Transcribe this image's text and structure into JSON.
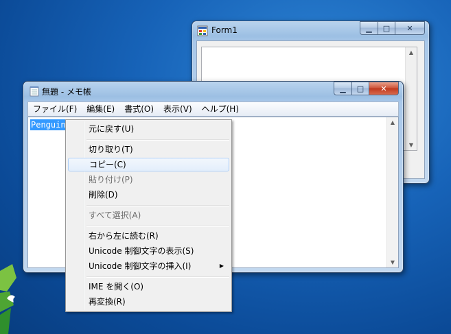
{
  "form1": {
    "title": "Form1"
  },
  "notepad": {
    "title": "無題 - メモ帳",
    "menu": [
      "ファイル(F)",
      "編集(E)",
      "書式(O)",
      "表示(V)",
      "ヘルプ(H)"
    ],
    "content": "Penguin"
  },
  "context_menu": {
    "items": [
      {
        "label": "元に戻す(U)",
        "enabled": true
      },
      {
        "label": "切り取り(T)",
        "enabled": true
      },
      {
        "label": "コピー(C)",
        "enabled": true,
        "highlighted": true
      },
      {
        "label": "貼り付け(P)",
        "enabled": false
      },
      {
        "label": "削除(D)",
        "enabled": true
      },
      {
        "label": "すべて選択(A)",
        "enabled": false
      },
      {
        "label": "右から左に読む(R)",
        "enabled": true
      },
      {
        "label": "Unicode 制御文字の表示(S)",
        "enabled": true
      },
      {
        "label": "Unicode 制御文字の挿入(I)",
        "enabled": true,
        "submenu": true
      },
      {
        "label": "IME を開く(O)",
        "enabled": true
      },
      {
        "label": "再変換(R)",
        "enabled": true
      }
    ]
  },
  "icons": {
    "minimize": "minimize-icon",
    "maximize": "maximize-icon",
    "close": "close-icon",
    "scroll_up": "scroll-up-icon",
    "scroll_down": "scroll-down-icon",
    "submenu": "submenu-arrow-icon"
  },
  "colors": {
    "selection": "#3399ff",
    "desktop": "#1763b8",
    "close_button": "#c0391e"
  }
}
